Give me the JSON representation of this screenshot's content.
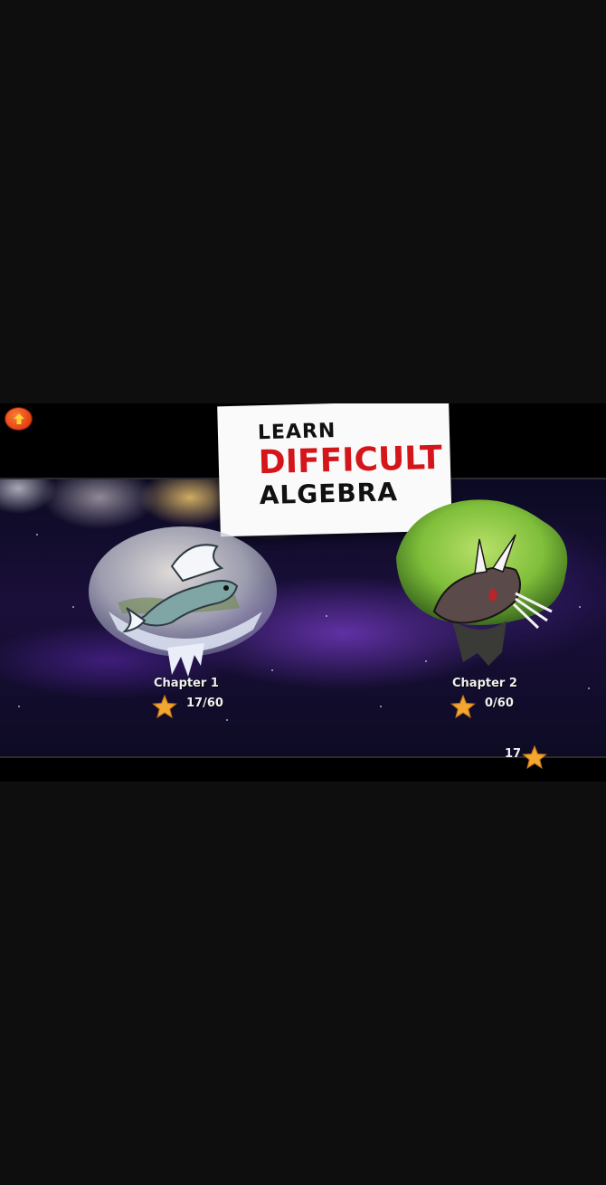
{
  "banner": {
    "line1": "LEARN",
    "line2": "DIFFICULT",
    "line3": "ALGEBRA"
  },
  "chapters": [
    {
      "label": "Chapter 1",
      "progress": "17/60",
      "stars_earned": 17,
      "stars_total": 60,
      "creature": "ice-dragon"
    },
    {
      "label": "Chapter 2",
      "progress": "0/60",
      "stars_earned": 0,
      "stars_total": 60,
      "creature": "horned-beast"
    }
  ],
  "total_stars": "17",
  "icons": {
    "back": "up-arrow-icon",
    "star": "star-icon"
  },
  "colors": {
    "banner_accent": "#d4161b",
    "star": "#f3a632",
    "back_button": "#e24110"
  }
}
